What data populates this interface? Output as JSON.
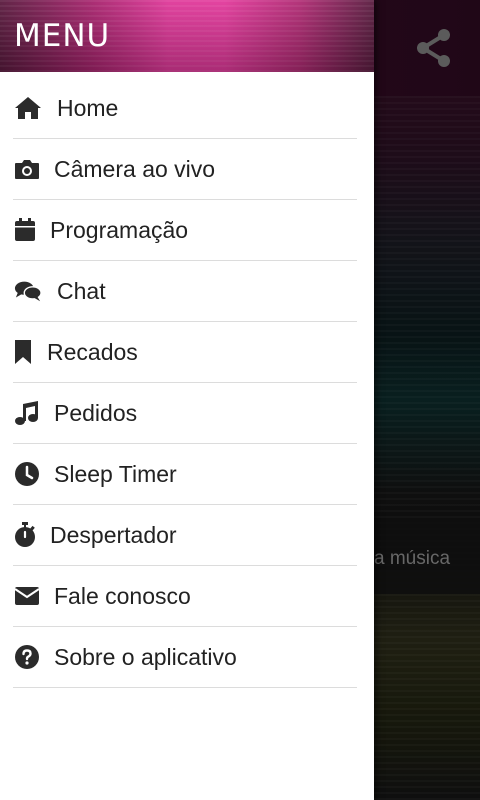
{
  "header": {
    "title": "MENU"
  },
  "menu": {
    "items": [
      {
        "label": "Home",
        "icon": "home-icon"
      },
      {
        "label": "Câmera ao vivo",
        "icon": "camera-icon"
      },
      {
        "label": "Programação",
        "icon": "calendar-icon"
      },
      {
        "label": "Chat",
        "icon": "chat-icon"
      },
      {
        "label": "Recados",
        "icon": "bookmark-icon"
      },
      {
        "label": "Pedidos",
        "icon": "music-note-icon"
      },
      {
        "label": "Sleep Timer",
        "icon": "clock-icon"
      },
      {
        "label": "Despertador",
        "icon": "stopwatch-icon"
      },
      {
        "label": "Fale conosco",
        "icon": "envelope-icon"
      },
      {
        "label": "Sobre o aplicativo",
        "icon": "help-circle-icon"
      }
    ]
  },
  "background": {
    "now_playing_fragment": "a música",
    "share_icon": "share-icon"
  },
  "colors": {
    "header_accent": "#e0399a",
    "icon": "#2b2b2b",
    "text": "#222222",
    "divider": "#dcdcdc"
  }
}
